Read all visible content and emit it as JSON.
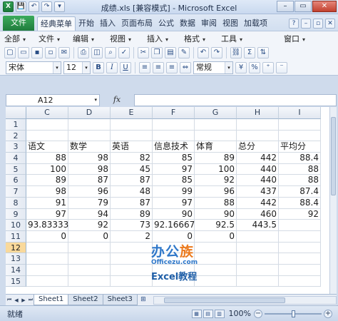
{
  "window": {
    "title": "成绩.xls [兼容模式] - Microsoft Excel",
    "quick_access": [
      "X",
      "💾",
      "↶",
      "↷",
      "▾"
    ]
  },
  "ribbon": {
    "file_tab": "文件",
    "tabs": [
      "经典菜单",
      "开始",
      "插入",
      "页面布局",
      "公式",
      "数据",
      "审阅",
      "视图",
      "加载项"
    ]
  },
  "menu": {
    "items": [
      "全部",
      "文件",
      "编辑",
      "视图",
      "插入",
      "格式",
      "工具",
      "窗口"
    ]
  },
  "toolbar": {
    "font_name": "宋体",
    "font_size": "12",
    "bold": "B",
    "italic": "I",
    "underline": "U",
    "number_format": "常规",
    "percent": "%"
  },
  "formula_bar": {
    "name_box": "A12",
    "fx": "fx",
    "formula": ""
  },
  "columns": [
    "C",
    "D",
    "E",
    "F",
    "G",
    "H",
    "I"
  ],
  "rows": [
    {
      "n": "1",
      "cells": [
        "",
        "",
        "",
        "",
        "",
        "",
        ""
      ]
    },
    {
      "n": "2",
      "cells": [
        "",
        "",
        "",
        "",
        "",
        "",
        ""
      ]
    },
    {
      "n": "3",
      "cells": [
        "语文",
        "数学",
        "英语",
        "信息技术",
        "体育",
        "总分",
        "平均分"
      ]
    },
    {
      "n": "4",
      "cells": [
        "88",
        "98",
        "82",
        "85",
        "89",
        "442",
        "88.4"
      ]
    },
    {
      "n": "5",
      "cells": [
        "100",
        "98",
        "45",
        "97",
        "100",
        "440",
        "88"
      ]
    },
    {
      "n": "6",
      "cells": [
        "89",
        "87",
        "87",
        "85",
        "92",
        "440",
        "88"
      ]
    },
    {
      "n": "7",
      "cells": [
        "98",
        "96",
        "48",
        "99",
        "96",
        "437",
        "87.4"
      ]
    },
    {
      "n": "8",
      "cells": [
        "91",
        "79",
        "87",
        "97",
        "88",
        "442",
        "88.4"
      ]
    },
    {
      "n": "9",
      "cells": [
        "97",
        "94",
        "89",
        "90",
        "90",
        "460",
        "92"
      ]
    },
    {
      "n": "10",
      "cells": [
        "93.83333",
        "92",
        "73",
        "92.16667",
        "92.5",
        "443.5",
        ""
      ]
    },
    {
      "n": "11",
      "cells": [
        "0",
        "0",
        "2",
        "0",
        "0",
        "",
        ""
      ]
    },
    {
      "n": "12",
      "cells": [
        "",
        "",
        "",
        "",
        "",
        "",
        ""
      ]
    },
    {
      "n": "13",
      "cells": [
        "",
        "",
        "",
        "",
        "",
        "",
        ""
      ]
    },
    {
      "n": "14",
      "cells": [
        "",
        "",
        "",
        "",
        "",
        "",
        ""
      ]
    },
    {
      "n": "15",
      "cells": [
        "",
        "",
        "",
        "",
        "",
        "",
        ""
      ]
    }
  ],
  "sheet_tabs": [
    "Sheet1",
    "Sheet2",
    "Sheet3"
  ],
  "status": {
    "ready": "就绪",
    "zoom": "100%"
  },
  "watermark": {
    "logo_a": "办公",
    "logo_b": "族",
    "site": "Officezu.com",
    "sub": "Excel教程"
  }
}
